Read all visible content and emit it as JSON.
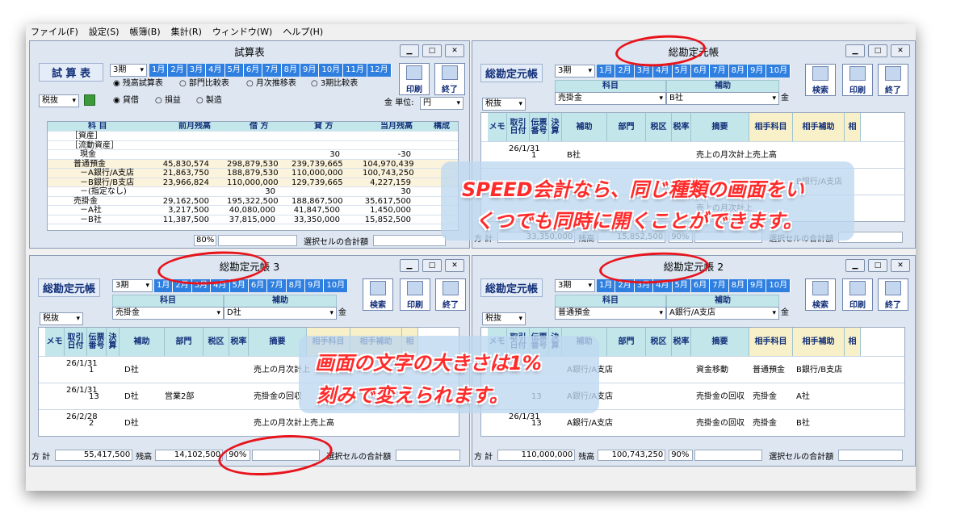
{
  "menu": [
    "ファイル(F)",
    "設定(S)",
    "帳簿(B)",
    "集計(R)",
    "ウィンドウ(W)",
    "ヘルプ(H)"
  ],
  "months": [
    "1月",
    "2月",
    "3月",
    "4月",
    "5月",
    "6月",
    "7月",
    "8月",
    "9月",
    "10月",
    "11月",
    "12月"
  ],
  "win1": {
    "title": "試算表",
    "head": "試 算 表",
    "period": "3期",
    "tax": "税抜",
    "radios1": [
      "残高試算表",
      "部門比較表",
      "月次推移表",
      "3期比較表"
    ],
    "radios2": [
      "貸借",
      "損益",
      "製造"
    ],
    "unit_label": "単位:",
    "unit": "円",
    "zoom": "80%",
    "sum_label": "選択セルの合計額",
    "cols": [
      "科 目",
      "前月残高",
      "借 方",
      "貸 方",
      "当月残高",
      "構成"
    ],
    "rows": [
      [
        "［資産］",
        "",
        "",
        "",
        ""
      ],
      [
        "［流動資産］",
        "",
        "",
        "",
        ""
      ],
      [
        "現金",
        "",
        "",
        "30",
        "-30"
      ],
      [
        "普通預金",
        "45,830,574",
        "298,879,530",
        "239,739,665",
        "104,970,439"
      ],
      [
        "－A銀行/A支店",
        "21,863,750",
        "188,879,530",
        "110,000,000",
        "100,743,250"
      ],
      [
        "－B銀行/B支店",
        "23,966,824",
        "110,000,000",
        "129,739,665",
        "4,227,159"
      ],
      [
        "－(指定なし)",
        "",
        "30",
        "",
        "30"
      ],
      [
        "売掛金",
        "29,162,500",
        "195,322,500",
        "188,867,500",
        "35,617,500"
      ],
      [
        "－A社",
        "3,217,500",
        "40,080,000",
        "41,847,500",
        "1,450,000"
      ],
      [
        "－B社",
        "11,387,500",
        "37,815,000",
        "33,350,000",
        "15,852,500"
      ]
    ]
  },
  "ledger_cols": [
    "メモ",
    "取引日付",
    "伝票番号",
    "決算",
    "補助",
    "部門",
    "税区",
    "税率",
    "摘要",
    "相手科目",
    "相手補助",
    "相"
  ],
  "labels": {
    "kamoku": "科目",
    "hojo": "補助",
    "search": "検索",
    "print": "印刷",
    "end": "終了",
    "total": "方 計",
    "balance": "残高",
    "sum_label": "選択セルの合計額",
    "kin": "金"
  },
  "win2": {
    "title": "総勘定元帳",
    "head": "総勘定元帳",
    "period": "3期",
    "tax": "税抜",
    "account": "売掛金",
    "sub": "B社",
    "rows": [
      [
        "26/1/31",
        "1",
        "B社",
        "",
        "売上の月次計上",
        "売上高",
        ""
      ],
      [
        "",
        "",
        "",
        "",
        "",
        "",
        "B銀行/A支店"
      ],
      [
        "",
        "",
        "",
        "",
        "売上の月次計上",
        "",
        ""
      ]
    ],
    "total": "33,350,000",
    "balance": "15,852,500",
    "zoom": "90%"
  },
  "win3": {
    "title": "総勘定元帳 3",
    "head": "総勘定元帳",
    "period": "3期",
    "tax": "税抜",
    "account": "売掛金",
    "sub": "D社",
    "rows": [
      [
        "26/1/31",
        "1",
        "D社",
        "",
        "売上の月次計上",
        "",
        ""
      ],
      [
        "26/1/31",
        "13",
        "D社",
        "営業2部",
        "売掛金の回収",
        "",
        ""
      ],
      [
        "26/2/28",
        "2",
        "D社",
        "",
        "売上の月次計上",
        "売上高",
        ""
      ]
    ],
    "total": "55,417,500",
    "balance": "14,102,500",
    "zoom": "90%"
  },
  "win4": {
    "title": "総勘定元帳 2",
    "head": "総勘定元帳",
    "period": "3期",
    "tax": "税抜",
    "account": "普通預金",
    "sub": "A銀行/A支店",
    "rows": [
      [
        "",
        "",
        "A銀行/A支店",
        "",
        "資金移動",
        "普通預金",
        "B銀行/B支店"
      ],
      [
        "",
        "13",
        "A銀行/A支店",
        "",
        "売掛金の回収",
        "売掛金",
        "A社"
      ],
      [
        "26/1/31",
        "13",
        "A銀行/A支店",
        "",
        "売掛金の回収",
        "売掛金",
        "B社"
      ]
    ],
    "total": "110,000,000",
    "balance": "100,743,250",
    "zoom": "90%"
  },
  "callout1": [
    "SPEED会計なら、同じ種類の画面をい",
    "くつでも同時に開くことができます。"
  ],
  "callout2": [
    "画面の文字の大きさは1%",
    "刻みで変えられます。"
  ]
}
